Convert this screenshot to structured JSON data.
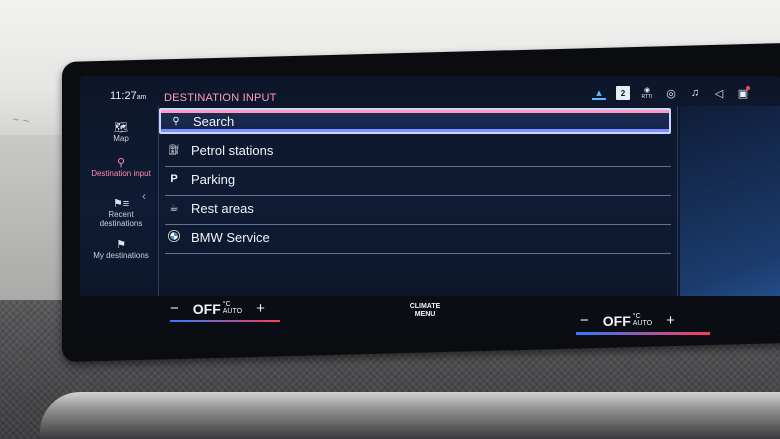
{
  "status": {
    "time": "11:27",
    "ampm": "am",
    "icons": [
      "chevron-up-icon",
      "num-2-badge",
      "rtti-icon",
      "connectivity-icon",
      "music-icon",
      "speaker-icon",
      "message-icon"
    ],
    "badge_text": "2",
    "rtti_text": "RTTI"
  },
  "screen_title": "DESTINATION INPUT",
  "nav": [
    {
      "icon": "map-icon",
      "label": "Map",
      "active": false
    },
    {
      "icon": "search-icon",
      "label": "Destination input",
      "active": true
    },
    {
      "icon": "recent-destinations-icon",
      "label": "Recent destinations",
      "active": false
    },
    {
      "icon": "flag-icon",
      "label": "My destinations",
      "active": false
    }
  ],
  "list": [
    {
      "icon": "search-icon",
      "label": "Search",
      "selected": true
    },
    {
      "icon": "fuel-pump-icon",
      "label": "Petrol stations",
      "selected": false
    },
    {
      "icon": "parking-icon",
      "label": "Parking",
      "selected": false
    },
    {
      "icon": "coffee-cup-icon",
      "label": "Rest areas",
      "selected": false
    },
    {
      "icon": "bmw-logo-icon",
      "label": "BMW Service",
      "selected": false
    }
  ],
  "climate": {
    "left": {
      "state": "OFF",
      "unit_top": "°C",
      "unit_bottom": "AUTO",
      "minus": "−",
      "plus": "+"
    },
    "right": {
      "state": "OFF",
      "unit_top": "°C",
      "unit_bottom": "AUTO",
      "minus": "−",
      "plus": "+"
    },
    "menu_label_1": "CLIMATE",
    "menu_label_2": "MENU"
  },
  "colors": {
    "accent_pink": "#ff8ab0",
    "accent_blue": "#5bb8ff",
    "screen_bg": "#0f1b33",
    "text": "#f2f4fa"
  }
}
